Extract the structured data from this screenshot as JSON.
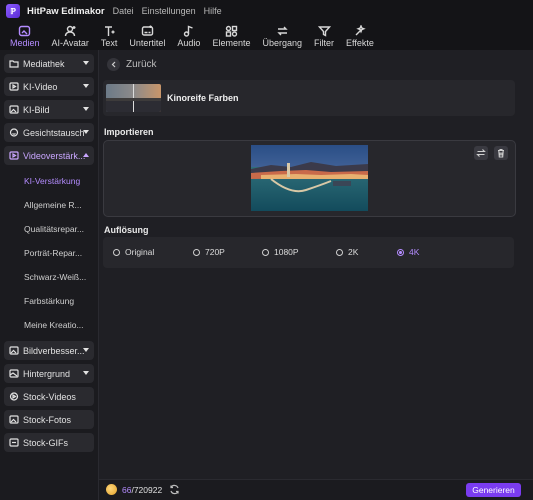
{
  "app": {
    "title": "HitPaw Edimakor",
    "logo_letter": "ℙ"
  },
  "menu": [
    "Datei",
    "Einstellungen",
    "Hilfe"
  ],
  "toolbar": [
    {
      "label": "Medien",
      "icon": "media-icon",
      "active": true
    },
    {
      "label": "AI-Avatar",
      "icon": "avatar-icon",
      "active": false
    },
    {
      "label": "Text",
      "icon": "text-icon",
      "active": false
    },
    {
      "label": "Untertitel",
      "icon": "subtitle-icon",
      "active": false
    },
    {
      "label": "Audio",
      "icon": "audio-icon",
      "active": false
    },
    {
      "label": "Elemente",
      "icon": "elements-icon",
      "active": false
    },
    {
      "label": "Übergang",
      "icon": "transition-icon",
      "active": false
    },
    {
      "label": "Filter",
      "icon": "filter-icon",
      "active": false
    },
    {
      "label": "Effekte",
      "icon": "effects-icon",
      "active": false
    }
  ],
  "sidebar": {
    "top_items": [
      {
        "label": "Mediathek",
        "icon": "folder-icon",
        "caret": true
      },
      {
        "label": "KI-Video",
        "icon": "video-icon",
        "caret": true
      },
      {
        "label": "KI-Bild",
        "icon": "image-icon",
        "caret": true
      },
      {
        "label": "Gesichtstausch",
        "icon": "face-swap-icon",
        "caret": true
      }
    ],
    "expanded": {
      "label": "Videoverstärk...",
      "icon": "video-enhance-icon"
    },
    "sub_items": [
      {
        "label": "KI-Verstärkung",
        "active": true
      },
      {
        "label": "Allgemeine R...",
        "active": false
      },
      {
        "label": "Qualitätsrepar...",
        "active": false
      },
      {
        "label": "Porträt-Repar...",
        "active": false
      },
      {
        "label": "Schwarz-Weiß...",
        "active": false
      },
      {
        "label": "Farbstärkung",
        "active": false
      },
      {
        "label": "Meine Kreatio...",
        "active": false
      }
    ],
    "bottom_items": [
      {
        "label": "Bildverbesser...",
        "icon": "image-enhance-icon",
        "caret": true
      },
      {
        "label": "Hintergrund",
        "icon": "background-icon",
        "caret": true
      },
      {
        "label": "Stock-Videos",
        "icon": "stock-video-icon",
        "caret": false
      },
      {
        "label": "Stock-Fotos",
        "icon": "stock-photo-icon",
        "caret": false
      },
      {
        "label": "Stock-GIFs",
        "icon": "stock-gif-icon",
        "caret": false
      }
    ]
  },
  "main": {
    "back_label": "Zurück",
    "preset_label": "Kinoreife Farben",
    "import_title": "Importieren",
    "resolution_title": "Auflösung",
    "resolutions": [
      {
        "label": "Original",
        "selected": false
      },
      {
        "label": "720P",
        "selected": false
      },
      {
        "label": "1080P",
        "selected": false
      },
      {
        "label": "2K",
        "selected": false
      },
      {
        "label": "4K",
        "selected": true
      }
    ]
  },
  "footer": {
    "credits_used": "66",
    "credits_total": "/720922",
    "generate_label": "Generieren"
  },
  "colors": {
    "accent": "#b48cff",
    "button": "#7a3cf0"
  }
}
